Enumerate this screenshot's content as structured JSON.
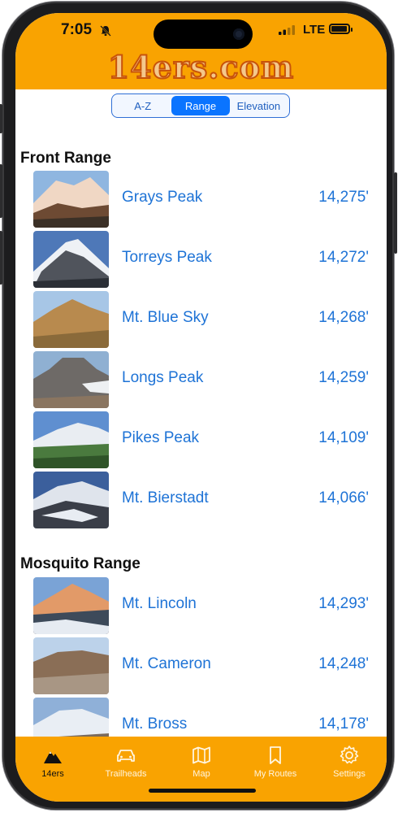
{
  "status_bar": {
    "time": "7:05",
    "network": "LTE",
    "battery_level": 0.85
  },
  "header": {
    "logo_text": "14ers.com"
  },
  "segments": [
    {
      "label": "A-Z",
      "active": false
    },
    {
      "label": "Range",
      "active": true
    },
    {
      "label": "Elevation",
      "active": false
    }
  ],
  "sections": [
    {
      "title": "Front Range",
      "peaks": [
        {
          "name": "Grays Peak",
          "elevation": "14,275'"
        },
        {
          "name": "Torreys Peak",
          "elevation": "14,272'"
        },
        {
          "name": "Mt. Blue Sky",
          "elevation": "14,268'"
        },
        {
          "name": "Longs Peak",
          "elevation": "14,259'"
        },
        {
          "name": "Pikes Peak",
          "elevation": "14,109'"
        },
        {
          "name": "Mt. Bierstadt",
          "elevation": "14,066'"
        }
      ]
    },
    {
      "title": "Mosquito Range",
      "peaks": [
        {
          "name": "Mt. Lincoln",
          "elevation": "14,293'"
        },
        {
          "name": "Mt. Cameron",
          "elevation": "14,248'"
        },
        {
          "name": "Mt. Bross",
          "elevation": "14,178'"
        }
      ]
    }
  ],
  "tabbar": {
    "items": [
      {
        "label": "14ers",
        "icon": "mountain-icon",
        "active": true
      },
      {
        "label": "Trailheads",
        "icon": "car-icon",
        "active": false
      },
      {
        "label": "Map",
        "icon": "map-icon",
        "active": false
      },
      {
        "label": "My Routes",
        "icon": "bookmark-icon",
        "active": false
      },
      {
        "label": "Settings",
        "icon": "gear-icon",
        "active": false
      }
    ]
  },
  "colors": {
    "accent": "#f9a301",
    "link": "#1e73d6",
    "segment_active": "#0a74ff"
  }
}
